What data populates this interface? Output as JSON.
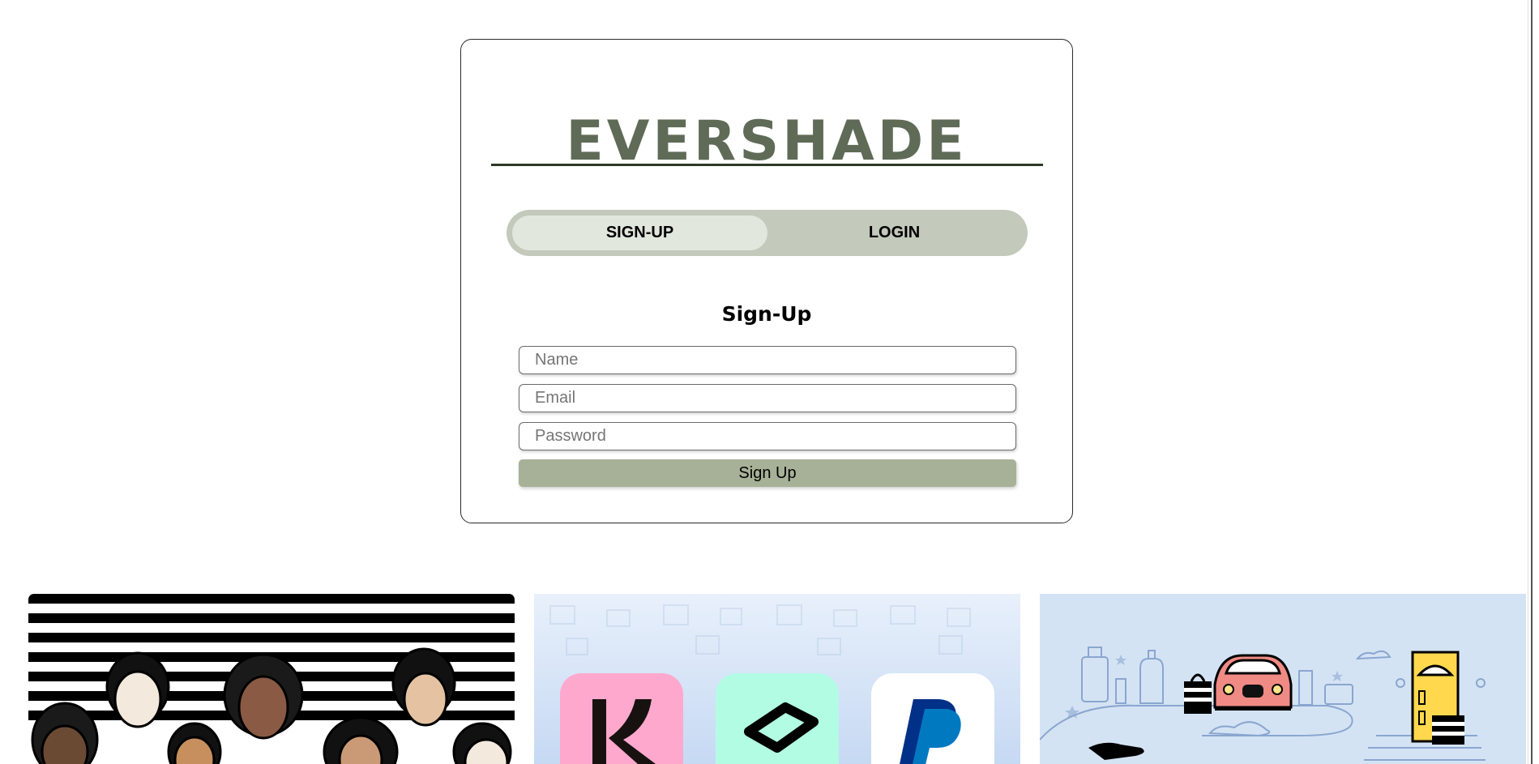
{
  "brand": {
    "name": "EVERSHADE"
  },
  "tabs": {
    "signup_label": "SIGN-UP",
    "login_label": "LOGIN",
    "active": "signup"
  },
  "signup_form": {
    "heading": "Sign-Up",
    "name_placeholder": "Name",
    "email_placeholder": "Email",
    "password_placeholder": "Password",
    "submit_label": "Sign Up"
  },
  "promos": [
    {
      "illustration": "diverse-women-portraits-striped-background"
    },
    {
      "illustration": "payment-apps",
      "apps": [
        "Klarna",
        "Afterpay",
        "PayPal"
      ]
    },
    {
      "illustration": "shopping-delivery-icons"
    }
  ],
  "colors": {
    "brand_text": "#5f6b57",
    "divider": "#2e3826",
    "tab_track": "#c3c9bb",
    "tab_active": "#e2e7de",
    "submit_bg": "#a7b197",
    "klarna_pink": "#ffa8cd",
    "afterpay_mint": "#b2fce4",
    "paypal_blue": "#003087"
  }
}
